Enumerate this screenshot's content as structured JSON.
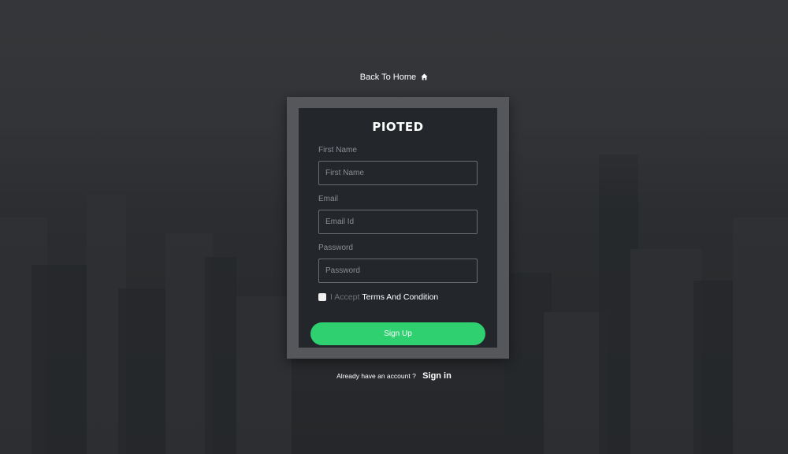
{
  "header": {
    "back_link_label": "Back To Home",
    "home_icon": "home-icon"
  },
  "brand": {
    "logo_text_left": "PIO",
    "logo_text_cross": "T",
    "logo_text_right": "ED"
  },
  "form": {
    "first_name": {
      "label": "First Name",
      "placeholder": "First Name",
      "value": ""
    },
    "email": {
      "label": "Email",
      "placeholder": "Email Id",
      "value": ""
    },
    "password": {
      "label": "Password",
      "placeholder": "Password",
      "value": ""
    },
    "accept_prefix": "I Accept",
    "terms_link": "Terms And Condition",
    "accept_checked": false,
    "submit_label": "Sign Up"
  },
  "footer": {
    "prompt": "Already have an account ?",
    "signin_label": "Sign in"
  },
  "colors": {
    "accent": "#2ed06f",
    "card_bg": "#23272c",
    "frame_bg": "#55575a"
  }
}
